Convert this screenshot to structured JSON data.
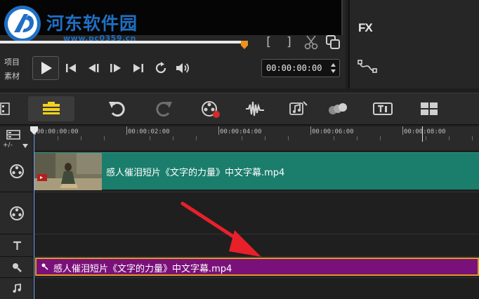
{
  "watermark": {
    "title": "河东软件园",
    "url": "www.pc0359.cn"
  },
  "player": {
    "mode_project_label": "项目",
    "mode_clip_label": "素材",
    "timecode": "00:00:00:00",
    "mark_in_label": "[",
    "mark_out_label": "]"
  },
  "fx_panel": {
    "fx_label": "FX"
  },
  "toolbar": {
    "icons": [
      "storyboard-view-icon",
      "timeline-view-icon",
      "undo-icon",
      "redo-icon",
      "record-capture-icon",
      "sound-mixer-icon",
      "auto-music-icon",
      "motion-tracking-icon",
      "subtitle-editor-icon",
      "multi-camera-icon"
    ]
  },
  "ruler": {
    "ticks": [
      "00:00:00:00",
      "00:00:02:00",
      "00:00:04:00",
      "00:00:06:00",
      "00:00:08:00"
    ]
  },
  "timeline": {
    "video_clip_name": "感人催泪短片《文字的力量》中文字幕.mp4",
    "audio_clip_name": "感人催泪短片《文字的力量》中文字幕.mp4"
  },
  "colors": {
    "video_clip": "#1b7d6c",
    "audio_clip": "#7a117a",
    "audio_clip_border": "#e39a1e",
    "scrub_thumb": "#f0901e",
    "annotation_arrow": "#e8202a",
    "watermark_blue": "#1f6fc4"
  }
}
